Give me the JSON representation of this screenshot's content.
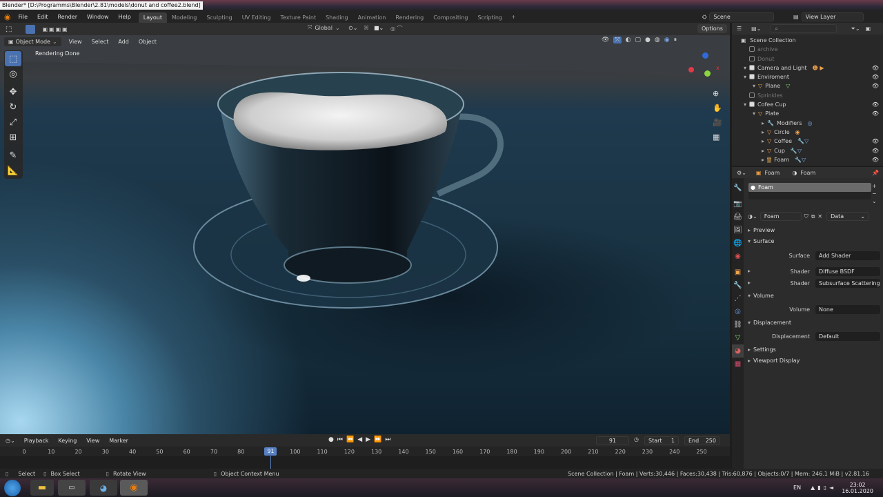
{
  "window": {
    "title": "Blender* [D:\\Programms\\Blender\\2.81\\models\\donut and coffee2.blend]"
  },
  "menu": [
    "File",
    "Edit",
    "Render",
    "Window",
    "Help"
  ],
  "workspaces": [
    "Layout",
    "Modeling",
    "Sculpting",
    "UV Editing",
    "Texture Paint",
    "Shading",
    "Animation",
    "Rendering",
    "Compositing",
    "Scripting"
  ],
  "active_workspace": "Layout",
  "scene": {
    "label": "Scene",
    "view_layer": "View Layer"
  },
  "viewport": {
    "transform_orientation": "Global",
    "options_label": "Options",
    "mode": "Object Mode",
    "menus": [
      "View",
      "Select",
      "Add",
      "Object"
    ],
    "status_text": "Rendering Done"
  },
  "outliner": {
    "root": "Scene Collection",
    "rows": [
      {
        "label": "archive",
        "dim": true,
        "indent": 0
      },
      {
        "label": "Donut",
        "dim": true,
        "indent": 0
      },
      {
        "label": "Camera and Light",
        "dim": false,
        "indent": 0
      },
      {
        "label": "Enviroment",
        "dim": false,
        "indent": 0
      },
      {
        "label": "Plane",
        "dim": false,
        "indent": 1
      },
      {
        "label": "Sprinkles",
        "dim": true,
        "indent": 0
      },
      {
        "label": "Cofee Cup",
        "dim": false,
        "indent": 0
      },
      {
        "label": "Plate",
        "dim": false,
        "indent": 1
      },
      {
        "label": "Modifiers",
        "dim": false,
        "indent": 2
      },
      {
        "label": "Circle",
        "dim": false,
        "indent": 2
      },
      {
        "label": "Coffee",
        "dim": false,
        "indent": 2
      },
      {
        "label": "Cup",
        "dim": false,
        "indent": 2
      },
      {
        "label": "Foam",
        "dim": false,
        "indent": 2
      }
    ]
  },
  "properties": {
    "object_name": "Foam",
    "material_name": "Foam",
    "slot_name": "Foam",
    "material_field": "Foam",
    "data_dropdown": "Data",
    "sections": {
      "preview": "Preview",
      "surface": "Surface",
      "volume": "Volume",
      "displacement": "Displacement",
      "settings": "Settings",
      "viewport_display": "Viewport Display"
    },
    "surface_label": "Surface",
    "surface_value": "Add Shader",
    "shader1_label": "Shader",
    "shader1_value": "Diffuse BSDF",
    "shader2_label": "Shader",
    "shader2_value": "Subsurface Scattering",
    "volume_label": "Volume",
    "volume_value": "None",
    "displacement_label": "Displacement",
    "displacement_value": "Default"
  },
  "timeline": {
    "menus": [
      "Playback",
      "Keying",
      "View",
      "Marker"
    ],
    "current_frame": "91",
    "start_label": "Start",
    "start": "1",
    "end_label": "End",
    "end": "250",
    "ticks": [
      "0",
      "10",
      "20",
      "30",
      "40",
      "50",
      "60",
      "70",
      "80",
      "90",
      "100",
      "110",
      "120",
      "130",
      "140",
      "150",
      "160",
      "170",
      "180",
      "190",
      "200",
      "210",
      "220",
      "230",
      "240",
      "250"
    ]
  },
  "statusbar": {
    "select": "Select",
    "box_select": "Box Select",
    "rotate": "Rotate View",
    "context": "Object Context Menu",
    "info": "Scene Collection | Foam | Verts:30,446 | Faces:30,438 | Tris:60,876 | Objects:0/7 | Mem: 246.1 MiB | v2.81.16"
  },
  "taskbar": {
    "lang": "EN",
    "time": "23:02",
    "date": "16.01.2020"
  },
  "colors": {
    "accent": "#4a72b0",
    "frame_marker": "#5680c2"
  }
}
